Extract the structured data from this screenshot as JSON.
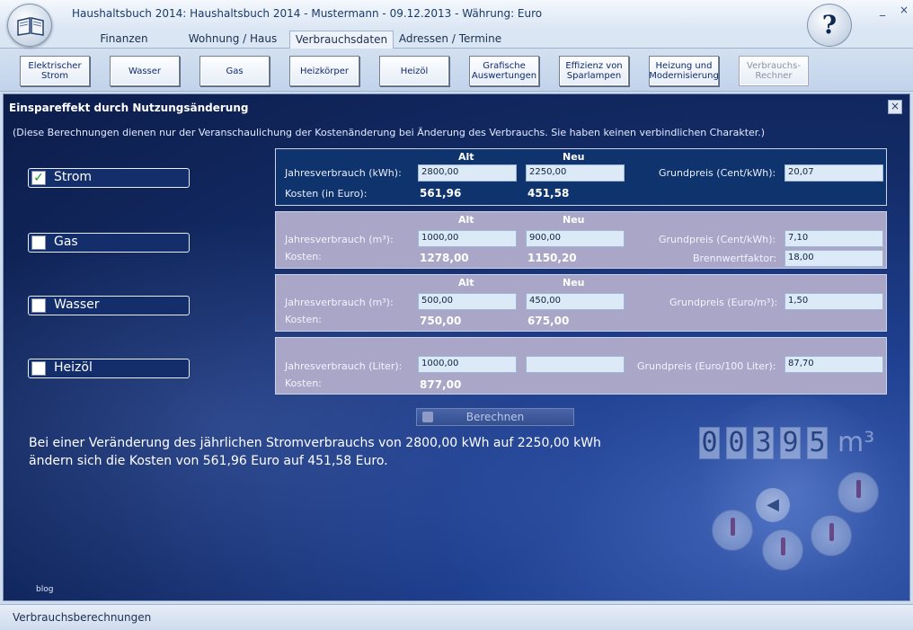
{
  "window": {
    "title": "Haushaltsbuch 2014: Haushaltsbuch 2014 - Mustermann - 09.12.2013 - Währung: Euro",
    "help": "?",
    "controls": [
      "_",
      "×"
    ]
  },
  "tabs": [
    {
      "label": "Finanzen",
      "active": false
    },
    {
      "label": "Wohnung / Haus",
      "active": false
    },
    {
      "label": "Verbrauchsdaten",
      "active": true
    },
    {
      "label": "Adressen / Termine",
      "active": false
    }
  ],
  "toolbar": [
    {
      "label": "Elektrischer Strom",
      "enabled": true
    },
    {
      "label": "Wasser",
      "enabled": true
    },
    {
      "label": "Gas",
      "enabled": true
    },
    {
      "label": "Heizkörper",
      "enabled": true
    },
    {
      "label": "Heizöl",
      "enabled": true
    },
    {
      "label": "Grafische Auswertungen",
      "enabled": true
    },
    {
      "label": "Effizienz von Sparlampen",
      "enabled": true
    },
    {
      "label": "Heizung und Modernisierung",
      "enabled": true
    },
    {
      "label": "Verbrauchs-Rechner",
      "enabled": false
    }
  ],
  "panel": {
    "title": "Einspareffekt durch Nutzungsänderung",
    "close": "×",
    "note": "(Diese Berechnungen dienen nur der Veranschaulichung der Kostenänderung bei Änderung des Verbrauchs. Sie haben keinen verbindlichen Charakter.)"
  },
  "rows": [
    {
      "name": "Strom",
      "checked": true,
      "col_alt": "Alt",
      "col_neu": "Neu",
      "usage_label": "Jahresverbrauch (kWh):",
      "old_usage": "2800,00",
      "new_usage": "2250,00",
      "cost_label": "Kosten (in Euro):",
      "old_cost": "561,96",
      "new_cost": "451,58",
      "price_label": "Grundpreis (Cent/kWh):",
      "price": "20,07"
    },
    {
      "name": "Gas",
      "checked": false,
      "col_alt": "Alt",
      "col_neu": "Neu",
      "usage_label": "Jahresverbrauch (m³):",
      "old_usage": "1000,00",
      "new_usage": "900,00",
      "cost_label": "Kosten:",
      "old_cost": "1278,00",
      "new_cost": "1150,20",
      "price_label": "Grundpreis (Cent/kWh):",
      "price": "7,10",
      "extra_label": "Brennwertfaktor:",
      "extra": "18,00"
    },
    {
      "name": "Wasser",
      "checked": false,
      "col_alt": "Alt",
      "col_neu": "Neu",
      "usage_label": "Jahresverbrauch (m³):",
      "old_usage": "500,00",
      "new_usage": "450,00",
      "cost_label": "Kosten:",
      "old_cost": "750,00",
      "new_cost": "675,00",
      "price_label": "Grundpreis (Euro/m³):",
      "price": "1,50"
    },
    {
      "name": "Heizöl",
      "checked": false,
      "usage_label": "Jahresverbrauch (Liter):",
      "old_usage": "1000,00",
      "new_usage": "",
      "cost_label": "Kosten:",
      "old_cost": "877,00",
      "price_label": "Grundpreis (Euro/100 Liter):",
      "price": "87,70"
    }
  ],
  "calc_button": "Berechnen",
  "result": {
    "line1": "Bei einer Veränderung des jährlichen Stromverbrauchs von 2800,00 kWh auf 2250,00 kWh",
    "line2": "ändern sich die Kosten von 561,96 Euro auf 451,58 Euro."
  },
  "meter": {
    "digits": [
      "0",
      "0",
      "3",
      "9",
      "5"
    ],
    "unit": "m³"
  },
  "blog_label": "blog",
  "status": "Verbrauchsberechnungen"
}
